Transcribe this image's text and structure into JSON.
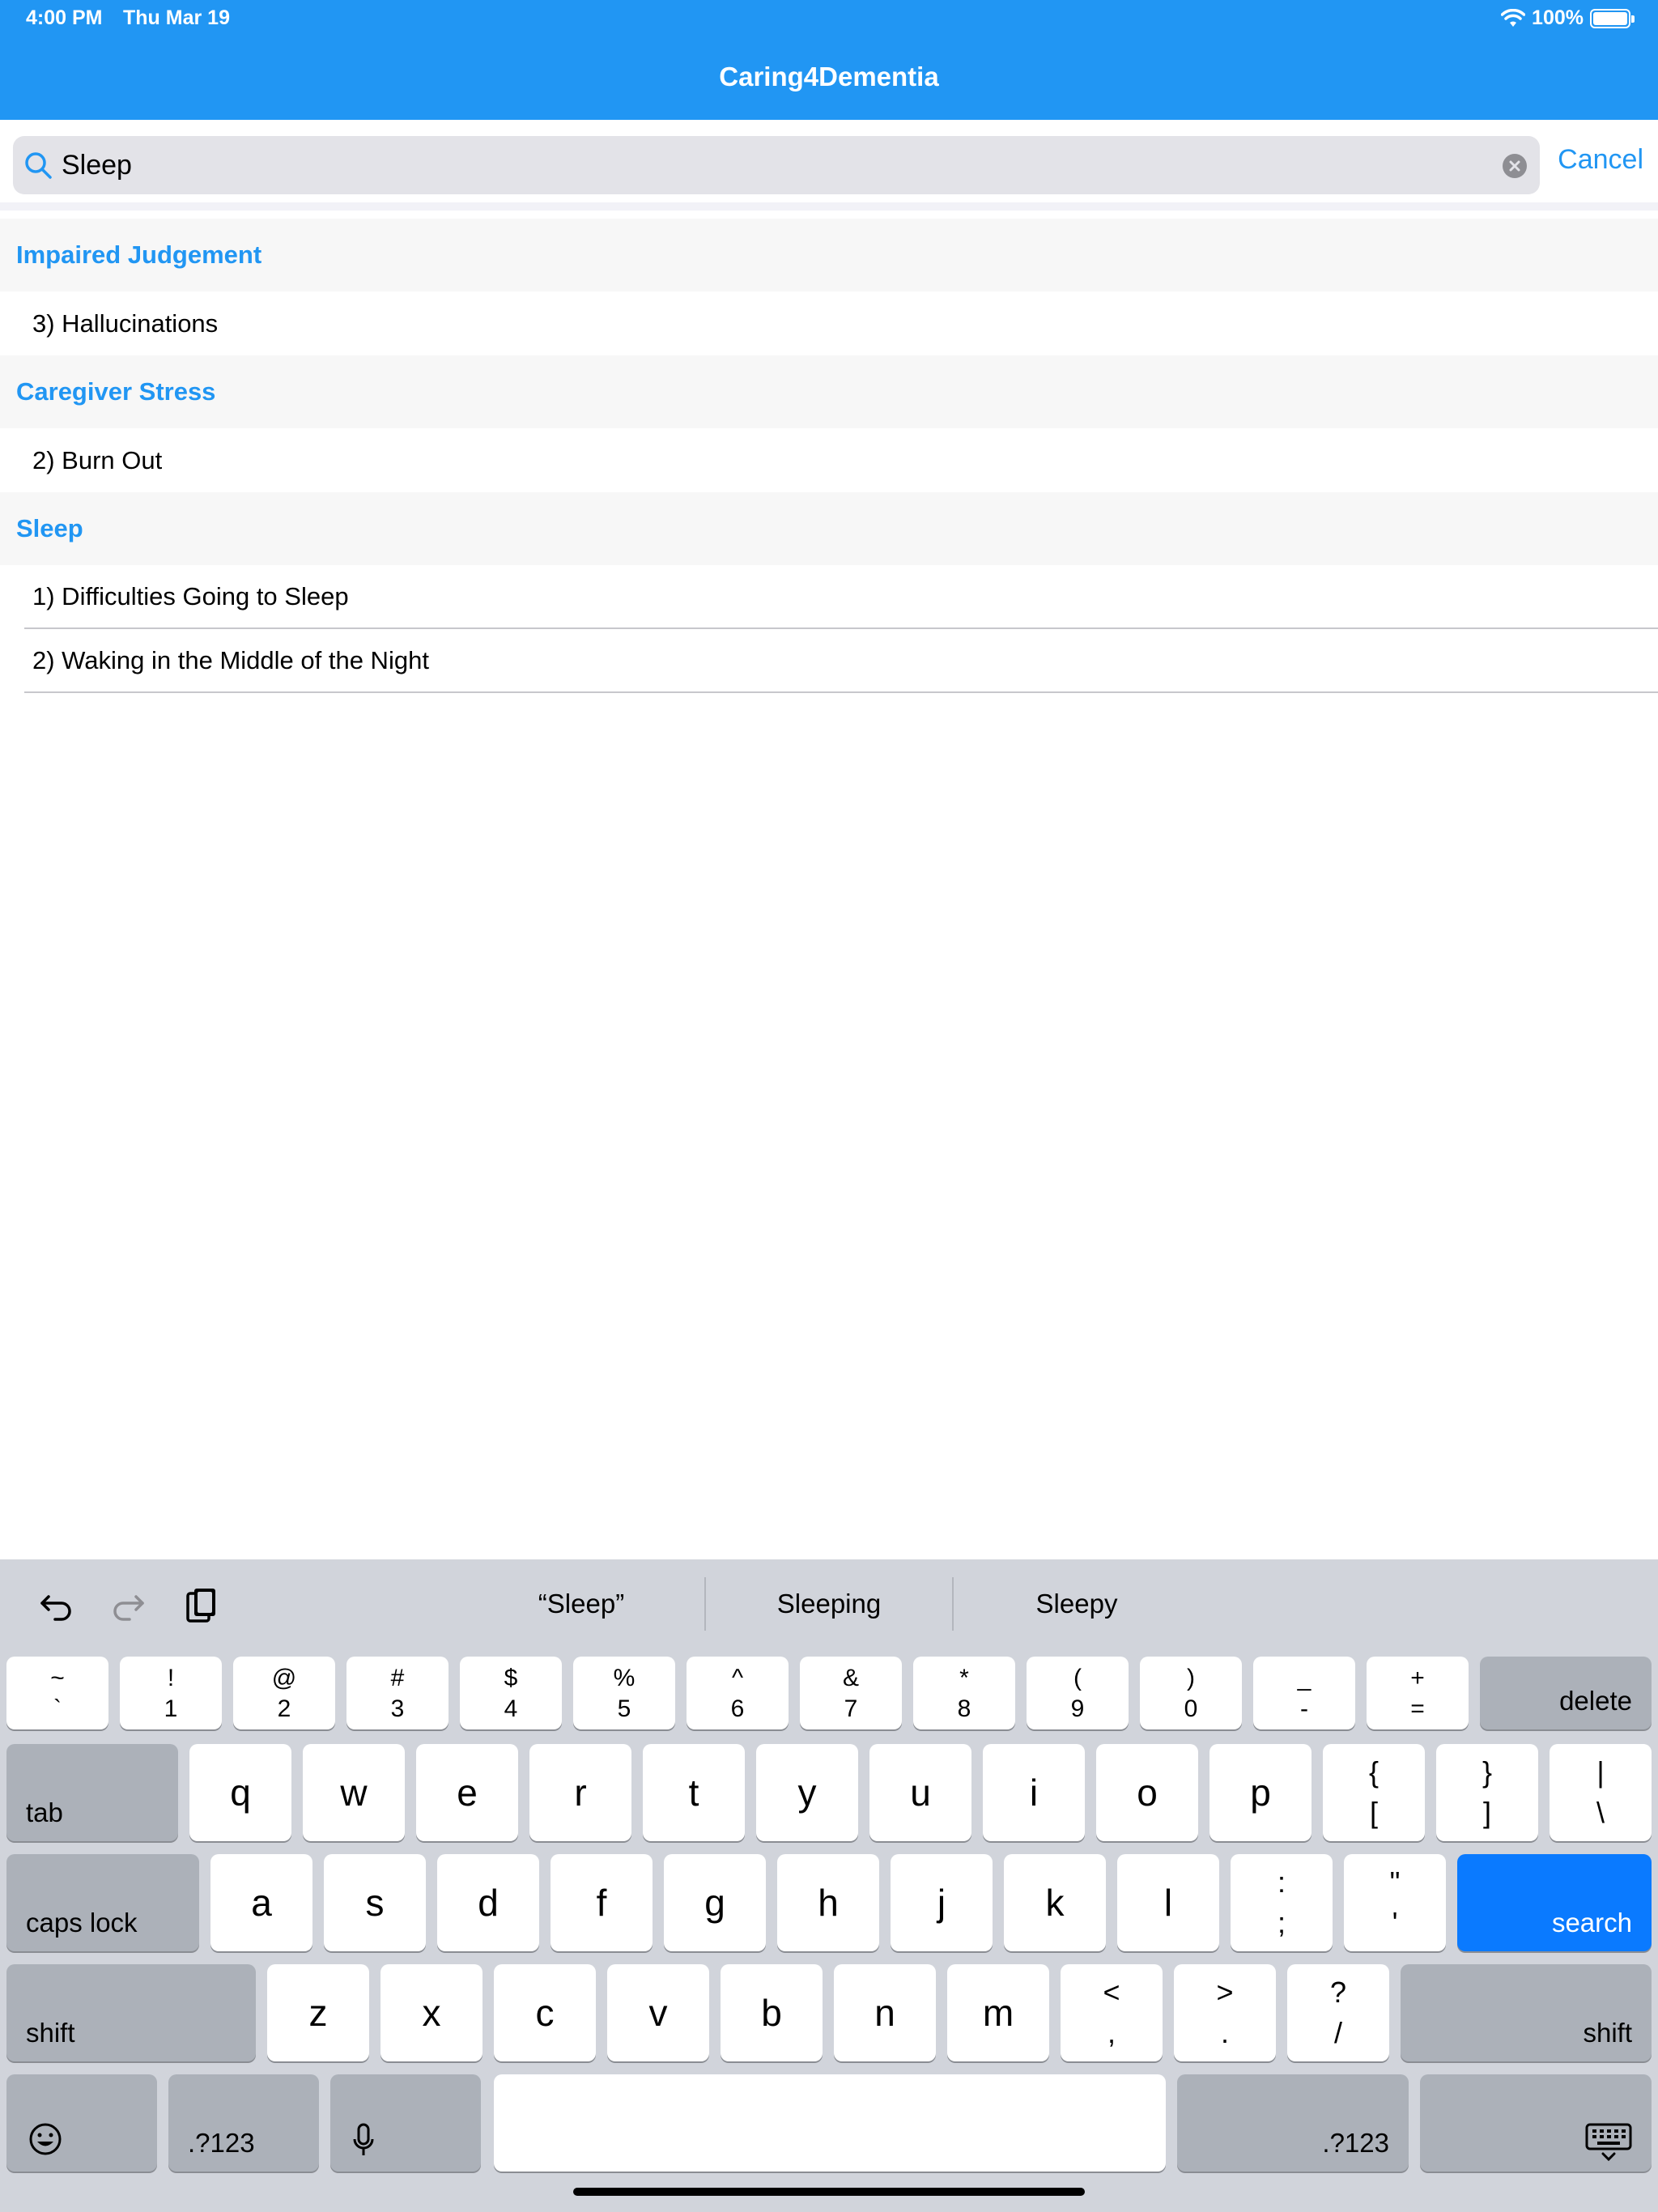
{
  "status_bar": {
    "time": "4:00 PM",
    "date": "Thu Mar 19",
    "battery": "100%"
  },
  "app": {
    "title": "Caring4Dementia"
  },
  "search": {
    "value": "Sleep",
    "cancel_label": "Cancel"
  },
  "results": {
    "sections": [
      {
        "title": "Impaired Judgement",
        "items": [
          "3) Hallucinations"
        ]
      },
      {
        "title": "Caregiver Stress",
        "items": [
          "2) Burn Out"
        ]
      },
      {
        "title": "Sleep",
        "items": [
          "1) Difficulties Going to Sleep",
          "2) Waking in the Middle of the Night"
        ]
      }
    ]
  },
  "keyboard": {
    "suggestions": [
      "“Sleep”",
      "Sleeping",
      "Sleepy"
    ],
    "number_row": [
      {
        "top": "~",
        "bot": "`"
      },
      {
        "top": "!",
        "bot": "1"
      },
      {
        "top": "@",
        "bot": "2"
      },
      {
        "top": "#",
        "bot": "3"
      },
      {
        "top": "$",
        "bot": "4"
      },
      {
        "top": "%",
        "bot": "5"
      },
      {
        "top": "^",
        "bot": "6"
      },
      {
        "top": "&",
        "bot": "7"
      },
      {
        "top": "*",
        "bot": "8"
      },
      {
        "top": "(",
        "bot": "9"
      },
      {
        "top": ")",
        "bot": "0"
      },
      {
        "top": "_",
        "bot": "-"
      },
      {
        "top": "+",
        "bot": "="
      }
    ],
    "delete_label": "delete",
    "tab_label": "tab",
    "row_q": [
      "q",
      "w",
      "e",
      "r",
      "t",
      "y",
      "u",
      "i",
      "o",
      "p"
    ],
    "row_q_symbols": [
      {
        "top": "{",
        "bot": "["
      },
      {
        "top": "}",
        "bot": "]"
      },
      {
        "top": "|",
        "bot": "\\"
      }
    ],
    "caps_label": "caps lock",
    "row_a": [
      "a",
      "s",
      "d",
      "f",
      "g",
      "h",
      "j",
      "k",
      "l"
    ],
    "row_a_symbols": [
      {
        "top": ":",
        "bot": ";"
      },
      {
        "top": "\"",
        "bot": "'"
      }
    ],
    "search_label": "search",
    "shift_label": "shift",
    "row_z": [
      "z",
      "x",
      "c",
      "v",
      "b",
      "n",
      "m"
    ],
    "row_z_symbols": [
      {
        "top": "<",
        "bot": ","
      },
      {
        "top": ">",
        "bot": "."
      },
      {
        "top": "?",
        "bot": "/"
      }
    ],
    "numbers_label": ".?123",
    "accent_color": "#0a7aff"
  },
  "colors": {
    "brand": "#2196f3",
    "section_bg": "#f7f7f7",
    "keyboard_bg": "#d1d4db"
  }
}
